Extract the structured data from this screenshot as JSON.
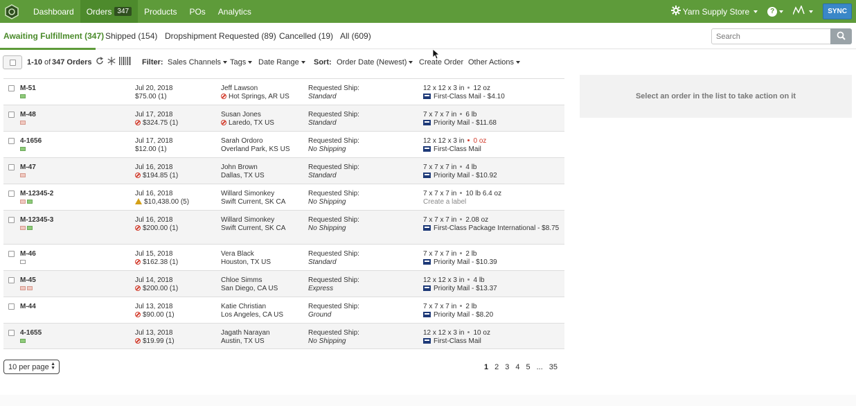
{
  "nav": {
    "items": [
      {
        "label": "Dashboard"
      },
      {
        "label": "Orders",
        "badge": "347"
      },
      {
        "label": "Products"
      },
      {
        "label": "POs"
      },
      {
        "label": "Analytics"
      }
    ],
    "store_name": "Yarn Supply Store",
    "help_label": "?",
    "sync_label": "SYNC"
  },
  "tabs": [
    {
      "label": "Awaiting Fulfillment (347)"
    },
    {
      "label": "Shipped (154)"
    },
    {
      "label": "Dropshipment Requested (89)"
    },
    {
      "label": "Cancelled (19)"
    },
    {
      "label": "All (609)"
    }
  ],
  "search": {
    "placeholder": "Search"
  },
  "toolbar": {
    "range_label": "1-10",
    "of_text": "of",
    "count_label": "347 Orders",
    "filter_label": "Filter:",
    "sales_channels": "Sales Channels",
    "tags": "Tags",
    "date_range": "Date Range",
    "sort_label": "Sort:",
    "sort_value": "Order Date (Newest)",
    "create_order": "Create Order",
    "other_actions": "Other Actions"
  },
  "orders": [
    {
      "id": "M-51",
      "date": "Jul 20, 2018",
      "amount": "$75.00 (1)",
      "amount_icon": "",
      "customer": "Jeff Lawson",
      "location": "Hot Springs, AR US",
      "location_icon": "no",
      "req_label": "Requested Ship:",
      "req_value": "Standard",
      "dims": "12 x 12 x 3 in",
      "weight": "12 oz",
      "weight_red": false,
      "service": "First-Class Mail - $4.10",
      "service_icon": "usps",
      "tags": [
        "green"
      ]
    },
    {
      "id": "M-48",
      "date": "Jul 17, 2018",
      "amount": "$324.75 (1)",
      "amount_icon": "no",
      "customer": "Susan Jones",
      "location": "Laredo, TX US",
      "location_icon": "no",
      "req_label": "Requested Ship:",
      "req_value": "Standard",
      "dims": "7 x 7 x 7 in",
      "weight": "6 lb",
      "weight_red": false,
      "service": "Priority Mail - $11.68",
      "service_icon": "usps",
      "tags": [
        "pink"
      ]
    },
    {
      "id": "4-1656",
      "date": "Jul 17, 2018",
      "amount": "$12.00 (1)",
      "amount_icon": "",
      "customer": "Sarah Ordoro",
      "location": "Overland Park, KS US",
      "location_icon": "",
      "req_label": "Requested Ship:",
      "req_value": "No Shipping",
      "dims": "12 x 12 x 3 in",
      "weight": "0 oz",
      "weight_red": true,
      "service": "First-Class Mail",
      "service_icon": "usps",
      "tags": [
        "green"
      ]
    },
    {
      "id": "M-47",
      "date": "Jul 16, 2018",
      "amount": "$194.85 (1)",
      "amount_icon": "no",
      "customer": "John Brown",
      "location": "Dallas, TX US",
      "location_icon": "",
      "req_label": "Requested Ship:",
      "req_value": "Standard",
      "dims": "7 x 7 x 7 in",
      "weight": "4 lb",
      "weight_red": false,
      "service": "Priority Mail - $10.92",
      "service_icon": "usps",
      "tags": [
        "pink"
      ]
    },
    {
      "id": "M-12345-2",
      "date": "Jul 16, 2018",
      "amount": "$10,438.00 (5)",
      "amount_icon": "warn",
      "customer": "Willard Simonkey",
      "location": "Swift Current, SK CA",
      "location_icon": "",
      "req_label": "Requested Ship:",
      "req_value": "No Shipping",
      "dims": "7 x 7 x 7 in",
      "weight": "10 lb  6.4 oz",
      "weight_red": false,
      "service": "Create a label",
      "service_icon": "",
      "tags": [
        "pink",
        "green"
      ]
    },
    {
      "id": "M-12345-3",
      "date": "Jul 16, 2018",
      "amount": "$200.00 (1)",
      "amount_icon": "no",
      "customer": "Willard Simonkey",
      "location": "Swift Current, SK CA",
      "location_icon": "",
      "req_label": "Requested Ship:",
      "req_value": "No Shipping",
      "dims": "7 x 7 x 7 in",
      "weight": "2.08 oz",
      "weight_red": false,
      "service": "First-Class Package International - $8.75",
      "service_icon": "usps",
      "tags": [
        "pink",
        "green"
      ],
      "tall": true
    },
    {
      "id": "M-46",
      "date": "Jul 15, 2018",
      "amount": "$162.38 (1)",
      "amount_icon": "no",
      "customer": "Vera Black",
      "location": "Houston, TX US",
      "location_icon": "",
      "req_label": "Requested Ship:",
      "req_value": "Standard",
      "dims": "7 x 7 x 7 in",
      "weight": "2 lb",
      "weight_red": false,
      "service": "Priority Mail - $10.39",
      "service_icon": "usps",
      "tags": [
        ""
      ]
    },
    {
      "id": "M-45",
      "date": "Jul 14, 2018",
      "amount": "$200.00 (1)",
      "amount_icon": "no",
      "customer": "Chloe Simms",
      "location": "San Diego, CA US",
      "location_icon": "",
      "req_label": "Requested Ship:",
      "req_value": "Express",
      "dims": "12 x 12 x 3 in",
      "weight": "4 lb",
      "weight_red": false,
      "service": "Priority Mail - $13.37",
      "service_icon": "usps",
      "tags": [
        "pink",
        "pink"
      ]
    },
    {
      "id": "M-44",
      "date": "Jul 13, 2018",
      "amount": "$90.00 (1)",
      "amount_icon": "no",
      "customer": "Katie Christian",
      "location": "Los Angeles, CA US",
      "location_icon": "",
      "req_label": "Requested Ship:",
      "req_value": "Ground",
      "dims": "7 x 7 x 7 in",
      "weight": "2 lb",
      "weight_red": false,
      "service": "Priority Mail - $8.20",
      "service_icon": "usps",
      "tags": []
    },
    {
      "id": "4-1655",
      "date": "Jul 13, 2018",
      "amount": "$19.99 (1)",
      "amount_icon": "no",
      "customer": "Jagath Narayan",
      "location": "Austin, TX US",
      "location_icon": "",
      "req_label": "Requested Ship:",
      "req_value": "No Shipping",
      "dims": "12 x 12 x 3 in",
      "weight": "10 oz",
      "weight_red": false,
      "service": "First-Class Mail",
      "service_icon": "usps",
      "tags": [
        "green"
      ]
    }
  ],
  "panel": {
    "message": "Select an order in the list to take action on it"
  },
  "footer": {
    "per_page": "10 per page",
    "pages": [
      "1",
      "2",
      "3",
      "4",
      "5",
      "...",
      "35"
    ]
  }
}
